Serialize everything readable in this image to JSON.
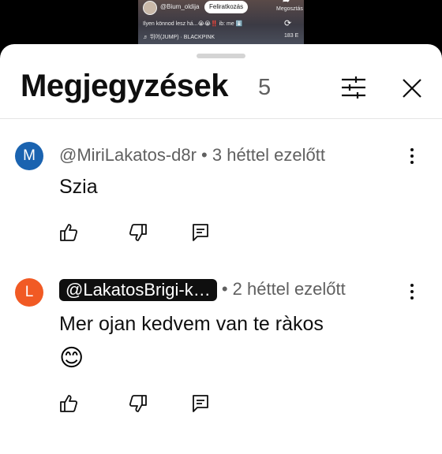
{
  "video": {
    "channel": "@Bium_oldija",
    "subscribe_label": "Feliratkozás",
    "share_label": "Megosztás",
    "caption": "Ilyen könnod lesz há...😭😭‼️ ib: me ⬇️",
    "music": "♬ 뛰어(JUMP) · BLACKPINK",
    "remix_count": "183 E"
  },
  "comments_header": {
    "title": "Megjegyzések",
    "count": "5"
  },
  "comments": [
    {
      "avatar_letter": "M",
      "avatar_color": "#1a63b0",
      "author": "@MiriLakatos-d8r",
      "time": " • 3 héttel ezelőtt",
      "text": "Szia",
      "emoji": ""
    },
    {
      "avatar_letter": "L",
      "avatar_color": "#f15a24",
      "author": "@LakatosBrigi-k…",
      "time": " • 2 héttel ezelőtt",
      "text": "Mer ojan kedvem van te ràkos",
      "emoji": "😊"
    }
  ],
  "icons": {
    "like": "thumbs-up-icon",
    "dislike": "thumbs-down-icon",
    "reply": "reply-comment-icon",
    "more": "more-vertical-icon",
    "filter": "filter-sliders-icon",
    "close": "close-icon"
  }
}
